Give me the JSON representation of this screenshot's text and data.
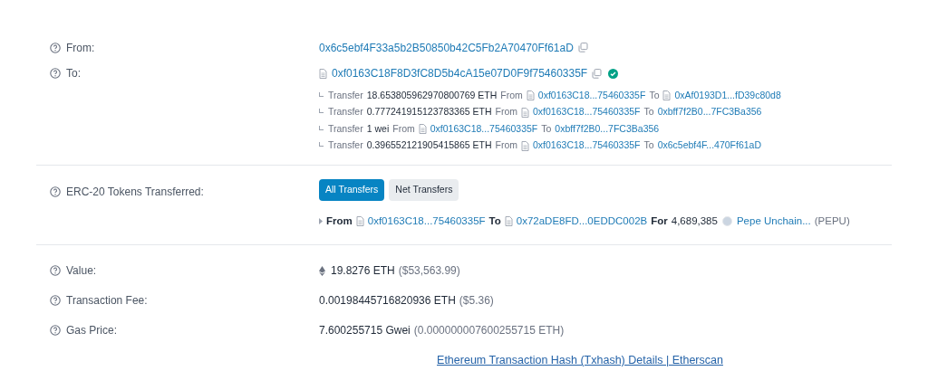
{
  "from": {
    "label": "From:",
    "address": "0x6c5ebf4F33a5b2B50850b42C5Fb2A70470Ff61aD"
  },
  "to": {
    "label": "To:",
    "address": "0xf0163C18F8D3fC8D5b4cA15e07D0F9f75460335F",
    "verified": true,
    "transfers": [
      {
        "verb": "Transfer",
        "amount": "18.653805962970800769 ETH",
        "from_label": "From",
        "from": "0xf0163C18...75460335F",
        "to_label": "To",
        "to": "0xAf0193D1...fD39c80d8",
        "to_contract": true
      },
      {
        "verb": "Transfer",
        "amount": "0.777241915123783365 ETH",
        "from_label": "From",
        "from": "0xf0163C18...75460335F",
        "to_label": "To",
        "to": "0xbff7f2B0...7FC3Ba356",
        "to_contract": false
      },
      {
        "verb": "Transfer",
        "amount": "1 wei",
        "from_label": "From",
        "from": "0xf0163C18...75460335F",
        "to_label": "To",
        "to": "0xbff7f2B0...7FC3Ba356",
        "to_contract": false
      },
      {
        "verb": "Transfer",
        "amount": "0.396552121905415865 ETH",
        "from_label": "From",
        "from": "0xf0163C18...75460335F",
        "to_label": "To",
        "to": "0x6c5ebf4F...470Ff61aD",
        "to_contract": false
      }
    ]
  },
  "erc20": {
    "label": "ERC-20 Tokens Transferred:",
    "tabs": [
      {
        "label": "All Transfers",
        "selected": true
      },
      {
        "label": "Net Transfers",
        "selected": false
      }
    ],
    "transfer": {
      "from_label": "From",
      "from": "0xf0163C18...75460335F",
      "to_label": "To",
      "to": "0x72aDE8FD...0EDDC002B",
      "for_label": "For",
      "amount": "4,689,385",
      "token": "Pepe Unchain...",
      "symbol": "(PEPU)"
    }
  },
  "value": {
    "label": "Value:",
    "amount": "19.8276 ETH",
    "usd": "($53,563.99)"
  },
  "fee": {
    "label": "Transaction Fee:",
    "amount": "0.00198445716820936 ETH",
    "usd": "($5.36)"
  },
  "gas": {
    "label": "Gas Price:",
    "amount": "7.600255715 Gwei",
    "eth": "(0.000000007600255715 ETH)"
  },
  "footer_link": "Ethereum Transaction Hash (Txhash) Details | Etherscan"
}
